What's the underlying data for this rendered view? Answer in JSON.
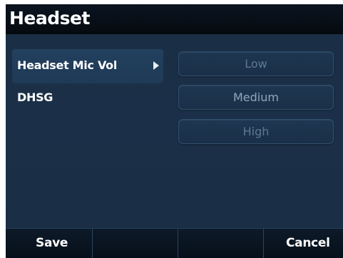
{
  "header": {
    "title": "Headset"
  },
  "menu": {
    "items": [
      {
        "label": "Headset Mic Vol",
        "selected": true,
        "has_submenu": true,
        "icon": "triangle-right-icon"
      },
      {
        "label": "DHSG",
        "selected": false,
        "has_submenu": false
      }
    ]
  },
  "options": {
    "items": [
      {
        "label": "Low"
      },
      {
        "label": "Medium"
      },
      {
        "label": "High"
      }
    ],
    "current": "Medium"
  },
  "softkeys": {
    "keys": [
      {
        "label": "Save"
      },
      {
        "label": ""
      },
      {
        "label": ""
      },
      {
        "label": "Cancel"
      }
    ]
  },
  "colors": {
    "background": "#1b3048",
    "header_background": "#050a10",
    "selected_item": "#22405e",
    "option_text": "#5d7894",
    "text": "#ffffff"
  }
}
